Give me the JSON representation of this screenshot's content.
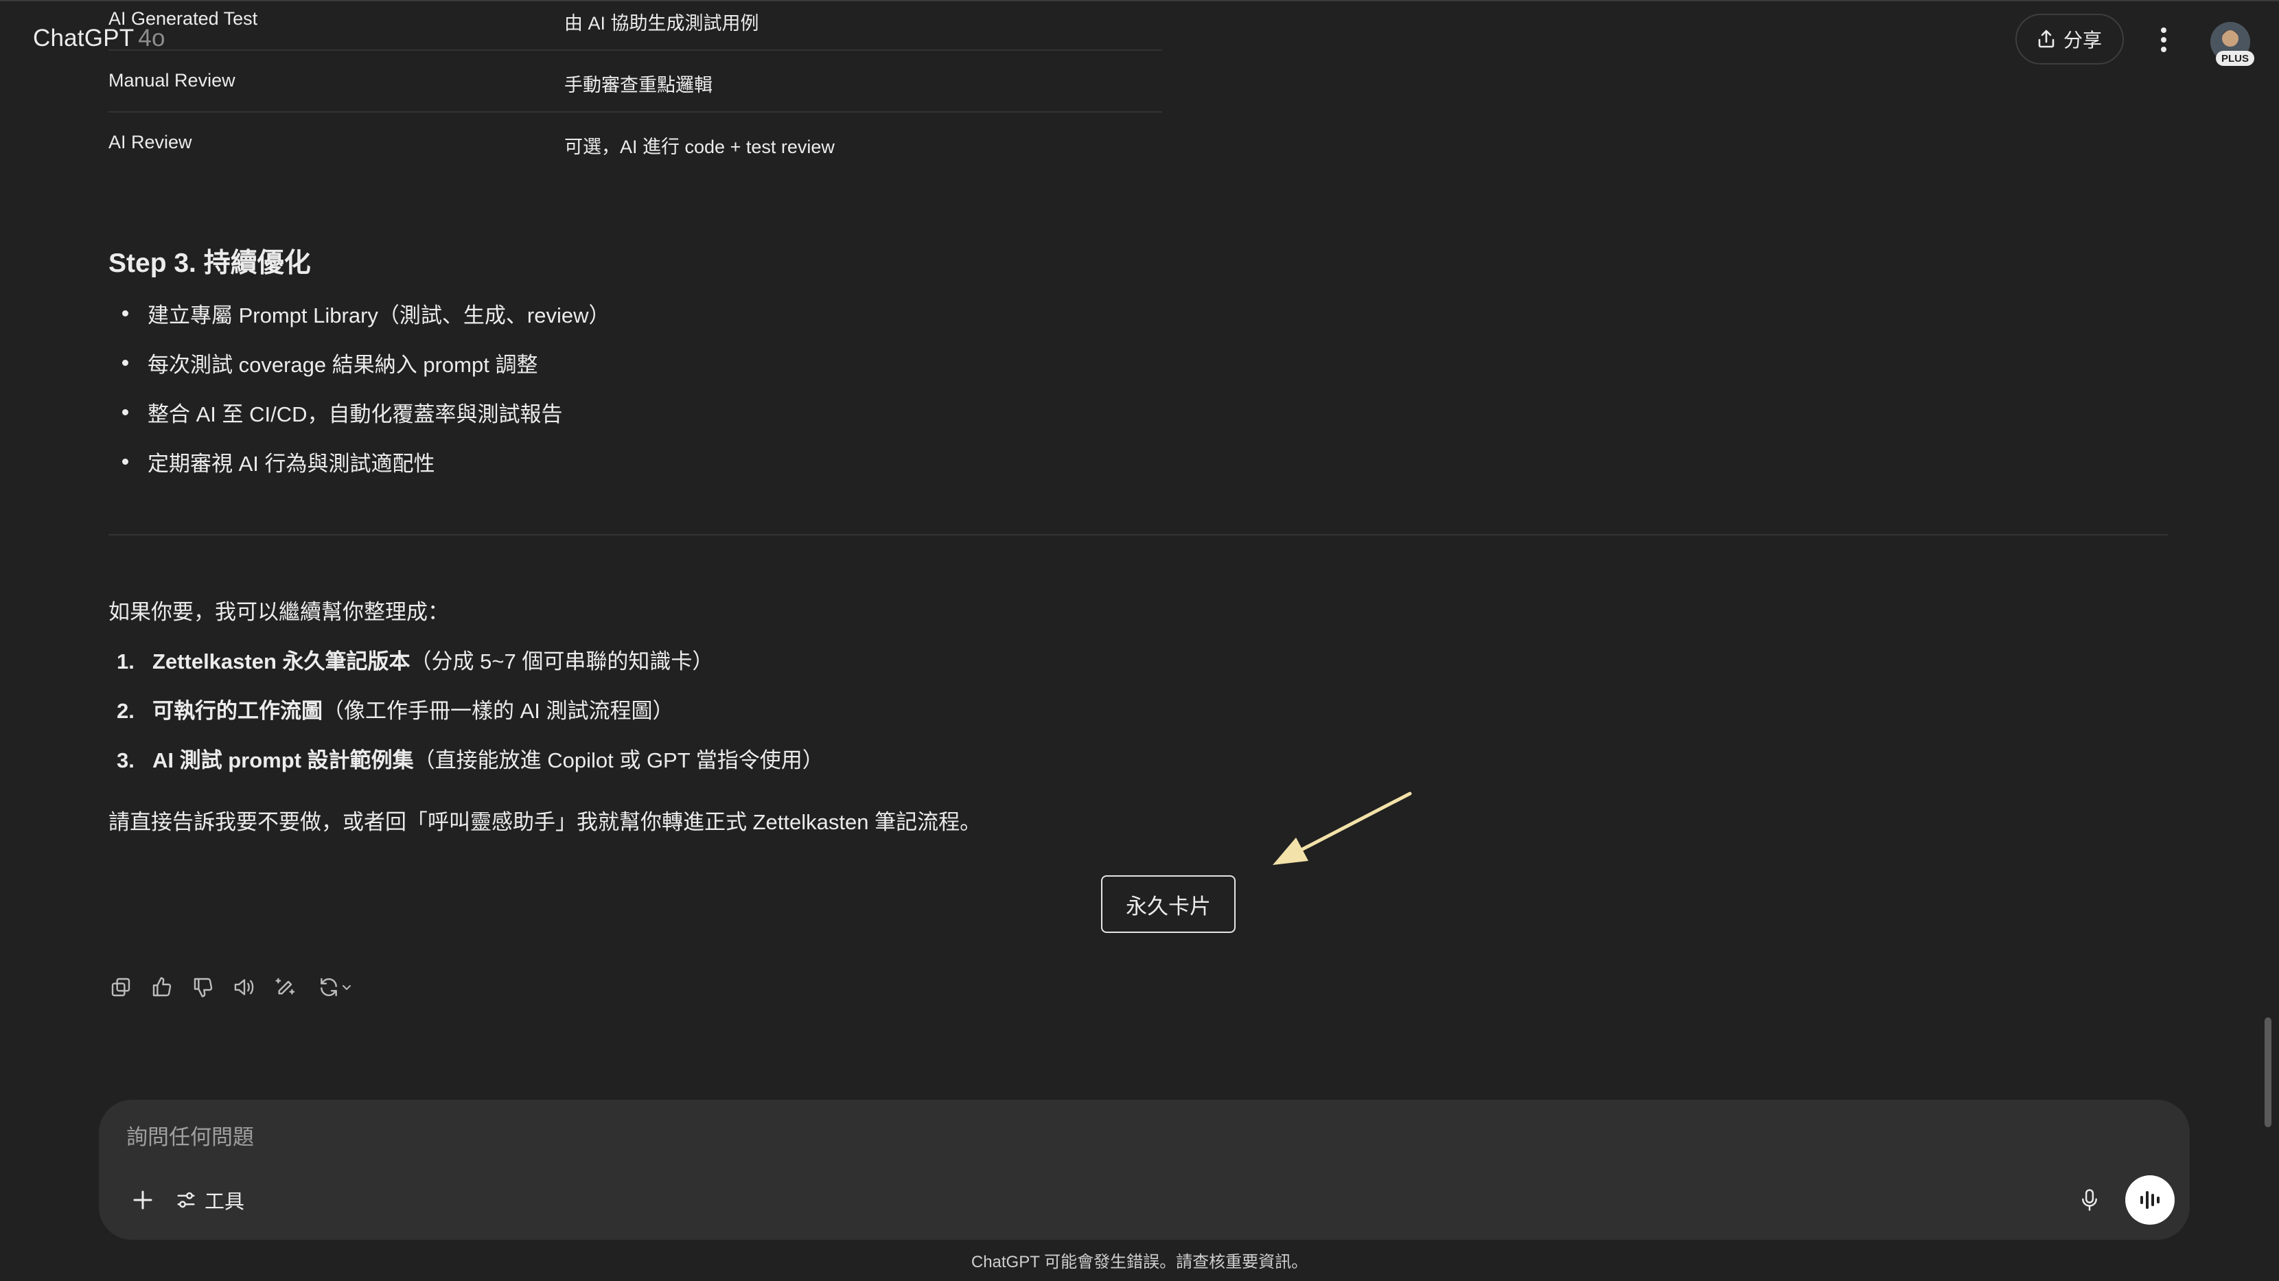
{
  "header": {
    "brand": "ChatGPT",
    "model": "4o",
    "share_label": "分享",
    "plan_badge": "PLUS"
  },
  "table": {
    "rows": [
      {
        "name": "AI Generated Test",
        "value": "由 AI 協助生成測試用例"
      },
      {
        "name": "Manual Review",
        "value": "手動審查重點邏輯"
      },
      {
        "name": "AI Review",
        "value": "可選，AI 進行 code + test review"
      }
    ]
  },
  "step3": {
    "title": "Step 3. 持續優化",
    "bullets": [
      "建立專屬 Prompt Library（測試、生成、review）",
      "每次測試 coverage 結果納入 prompt 調整",
      "整合 AI 至 CI/CD，自動化覆蓋率與測試報告",
      "定期審視 AI 行為與測試適配性"
    ]
  },
  "followup": {
    "intro": "如果你要，我可以繼續幫你整理成：",
    "options": [
      {
        "num": "1.",
        "bold": "Zettelkasten 永久筆記版本",
        "rest": "（分成 5~7 個可串聯的知識卡）"
      },
      {
        "num": "2.",
        "bold": "可執行的工作流圖",
        "rest": "（像工作手冊一樣的 AI 測試流程圖）"
      },
      {
        "num": "3.",
        "bold": "AI 測試 prompt 設計範例集",
        "rest": "（直接能放進 Copilot 或 GPT 當指令使用）"
      }
    ],
    "closing": "請直接告訴我要不要做，或者回「呼叫靈感助手」我就幫你轉進正式 Zettelkasten 筆記流程。"
  },
  "permanent_card_label": "永久卡片",
  "arrow_color": "#f3e2a9",
  "composer": {
    "placeholder": "詢問任何問題",
    "tools_label": "工具"
  },
  "footer_note": "ChatGPT 可能會發生錯誤。請查核重要資訊。"
}
